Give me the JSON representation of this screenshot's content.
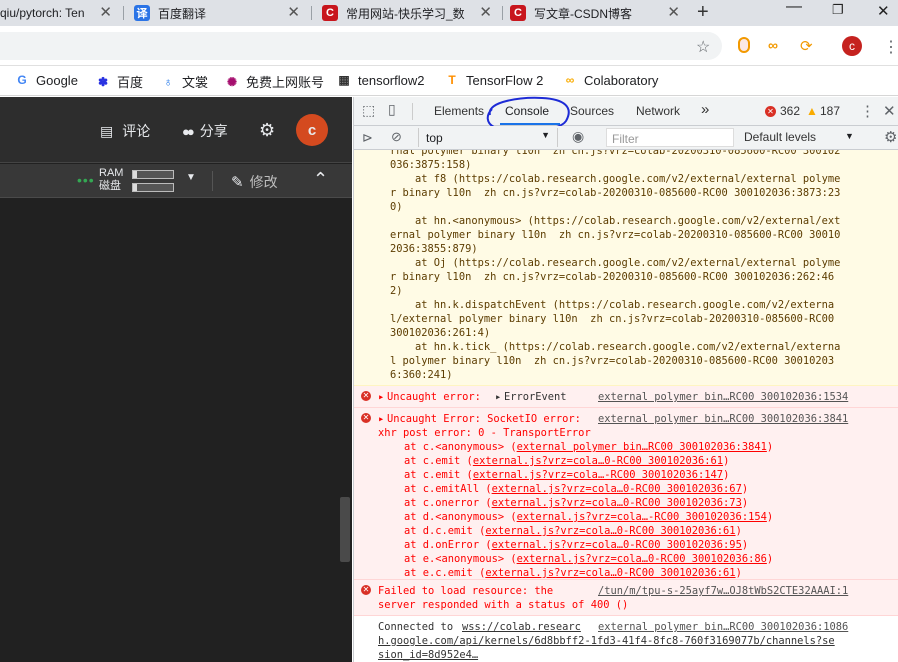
{
  "browser": {
    "tabs": [
      {
        "label": "qiu/pytorch: Ten",
        "icon": "github-icon"
      },
      {
        "label": "百度翻译",
        "icon": "baidu-translate-icon"
      },
      {
        "label": "常用网站-快乐学习_数",
        "icon": "csdn-icon"
      },
      {
        "label": "写文章-CSDN博客",
        "icon": "csdn-icon"
      }
    ],
    "new_tab": "+",
    "bookmarks": [
      {
        "label": "Google"
      },
      {
        "label": "百度"
      },
      {
        "label": "文裳"
      },
      {
        "label": "免费上网账号"
      },
      {
        "label": "tensorflow2"
      },
      {
        "label": "TensorFlow 2"
      },
      {
        "label": "Colaboratory"
      }
    ],
    "profile_letter": "c"
  },
  "colab": {
    "comment": "评论",
    "share": "分享",
    "avatar": "c",
    "ram_label": "RAM",
    "disk_label": "磁盘",
    "edit": "修改"
  },
  "devtools": {
    "tabs": [
      "Elements",
      "Console",
      "Sources",
      "Network"
    ],
    "more": "»",
    "errors": "362",
    "warnings": "187",
    "context": "top",
    "filter_placeholder": "Filter",
    "levels": "Default levels"
  },
  "console": {
    "warn_lines": [
      "rnal polymer binary l10n  zh cn.js?vrz=colab-20200310-085600-RC00 300102",
      "036:3875:158)",
      "    at f8 (https://colab.research.google.com/v2/external/external polyme",
      "r binary l10n  zh cn.js?vrz=colab-20200310-085600-RC00 300102036:3873:23",
      "0)",
      "    at hn.<anonymous> (https://colab.research.google.com/v2/external/ext",
      "ernal polymer binary l10n  zh cn.js?vrz=colab-20200310-085600-RC00 30010",
      "2036:3855:879)",
      "    at Oj (https://colab.research.google.com/v2/external/external polyme",
      "r binary l10n  zh cn.js?vrz=colab-20200310-085600-RC00 300102036:262:46",
      "2)",
      "    at hn.k.dispatchEvent (https://colab.research.google.com/v2/externa",
      "l/external polymer binary l10n  zh cn.js?vrz=colab-20200310-085600-RC00",
      "300102036:261:4)",
      "    at hn.k.tick_ (https://colab.research.google.com/v2/external/externa",
      "l polymer binary l10n  zh cn.js?vrz=colab-20200310-085600-RC00 30010203",
      "6:360:241)"
    ],
    "err1_msg": "Uncaught error: ",
    "err1_obj": "ErrorEvent",
    "err1_src": "external polymer bin…RC00 300102036:1534",
    "err2_msg": "Uncaught Error: SocketIO error:",
    "err2_src": "external polymer bin…RC00 300102036:3841",
    "err2_line2": "xhr post error: 0 - TransportError",
    "err2_stack": [
      {
        "fn": "at c.<anonymous> (",
        "link": "external polymer bin…RC00 300102036:3841",
        "end": ")"
      },
      {
        "fn": "at c.emit (",
        "link": "external.js?vrz=cola…0-RC00 300102036:61",
        "end": ")"
      },
      {
        "fn": "at c.emit (",
        "link": "external.js?vrz=cola…-RC00 300102036:147",
        "end": ")"
      },
      {
        "fn": "at c.emitAll (",
        "link": "external.js?vrz=cola…0-RC00 300102036:67",
        "end": ")"
      },
      {
        "fn": "at c.onerror (",
        "link": "external.js?vrz=cola…0-RC00 300102036:73",
        "end": ")"
      },
      {
        "fn": "at d.<anonymous> (",
        "link": "external.js?vrz=cola…-RC00 300102036:154",
        "end": ")"
      },
      {
        "fn": "at d.c.emit (",
        "link": "external.js?vrz=cola…0-RC00 300102036:61",
        "end": ")"
      },
      {
        "fn": "at d.onError (",
        "link": "external.js?vrz=cola…0-RC00 300102036:95",
        "end": ")"
      },
      {
        "fn": "at e.<anonymous> (",
        "link": "external.js?vrz=cola…0-RC00 300102036:86",
        "end": ")"
      },
      {
        "fn": "at e.c.emit (",
        "link": "external.js?vrz=cola…0-RC00 300102036:61",
        "end": ")"
      }
    ],
    "err3_msg": "Failed to load resource: the",
    "err3_src": "/tun/m/tpu-s-25ayf7w…OJ8tWbS2CTE32AAAI:1",
    "err3_line2": "server responded with a status of 400 ()",
    "info_msg": "Connected to ",
    "info_link1": "wss://colab.researc",
    "info_src": "external polymer bin…RC00 300102036:1086",
    "info_line2": "h.google.com/api/kernels/6d8bbff2-1fd3-41f4-8fc8-760f3169077b/channels?se",
    "info_line3": "sion_id=8d952e4…"
  }
}
